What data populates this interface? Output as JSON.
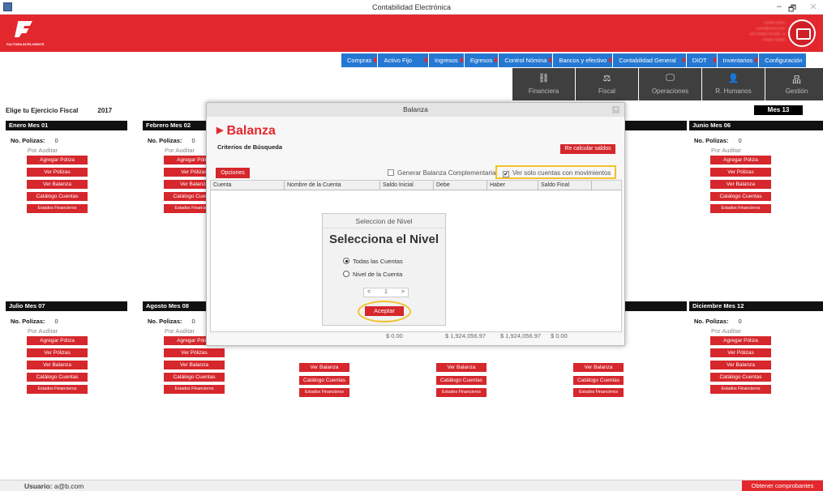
{
  "window": {
    "title": "Contabilidad Electrónica",
    "minimize": "–",
    "maximize": "🗗",
    "close": "✕"
  },
  "brand": {
    "logo_text": "FACTURA INTELIGENTE",
    "user_lines": [
      "Usuario Demo",
      "correo@correo.com",
      "RFC DEMO XXX000 - A",
      "Ciudad, Estado"
    ]
  },
  "menu": [
    {
      "label": "Compras",
      "id": "compras"
    },
    {
      "label": "Activo Fijo",
      "id": "activo-fijo"
    },
    {
      "label": "Ingresos",
      "id": "ingresos"
    },
    {
      "label": "Egresos",
      "id": "egresos"
    },
    {
      "label": "Control Nómina",
      "id": "control-nomina"
    },
    {
      "label": "Bancos y efectivo",
      "id": "bancos"
    },
    {
      "label": "Contabilidad General",
      "id": "contabilidad-general"
    },
    {
      "label": "DIOT",
      "id": "diot"
    },
    {
      "label": "Inventarios",
      "id": "inventarios"
    },
    {
      "label": "Configuración",
      "id": "configuracion"
    }
  ],
  "tiles": [
    {
      "label": "Financiera",
      "icon": "link-icon",
      "glyph": "⛓"
    },
    {
      "label": "Fiscal",
      "icon": "scale-icon",
      "glyph": "⚖"
    },
    {
      "label": "Operaciones",
      "icon": "monitor-icon",
      "glyph": "🖵"
    },
    {
      "label": "R. Humanos",
      "icon": "person-icon",
      "glyph": "👤"
    },
    {
      "label": "Gestión",
      "icon": "org-chart-icon",
      "glyph": "品"
    }
  ],
  "fiscal": {
    "label": "Elige tu Ejercicio Fiscal",
    "year": "2017",
    "mes13": "Mes 13"
  },
  "month_common": {
    "polizas_label": "No. Polizas:",
    "polizas_value": "0",
    "status": "Por Auditar",
    "btn_agregar": "Agregar Póliza",
    "btn_ver_polizas": "Ver Pólizas",
    "btn_ver_balanza": "Ver Balanza",
    "btn_catalogo": "Catálogo Cuentas",
    "btn_estados": "Estados Financieros"
  },
  "months": {
    "m01": "Enero Mes 01",
    "m02": "Febrero Mes 02",
    "m06": "Junio Mes 06",
    "m07": "Julio Mes 07",
    "m08": "Agosto Mes 08",
    "m12": "Diciembre Mes 12"
  },
  "modal": {
    "title": "Balanza",
    "close": "×",
    "heading": "Balanza",
    "criterios": "Criterios de Búsqueda",
    "recalc": "Re calcular saldos",
    "opciones": "Opciones",
    "chk_complementaria": "Generar Balanza Complementaria",
    "chk_movimientos": "Ver solo cuentas con movimientos",
    "columns": [
      "Cuenta",
      "Nombre de la Cuenta",
      "Saldo Inicial",
      "Debe",
      "Haber",
      "Saldo Final"
    ],
    "totals": {
      "saldo_inicial": "$ 0.00",
      "debe": "$ 1,924,056.97",
      "haber": "$ 1,924,056.97",
      "saldo_final": "$ 0.00"
    }
  },
  "nivel": {
    "header": "Seleccion de Nivel",
    "title": "Selecciona el Nivel",
    "opt_todas": "Todas las Cuentas",
    "opt_nivel": "Nivel de la Cuenta",
    "stepper_prev": "<",
    "stepper_value": "1",
    "stepper_next": ">",
    "aceptar": "Aceptar"
  },
  "status": {
    "user_label": "Usuario:",
    "user_value": "a@b.com",
    "obtener": "Obtener comprobantes"
  },
  "colors": {
    "brand_red": "#e3282d",
    "menu_blue": "#2478d2",
    "tile_dark": "#3f3f3f",
    "highlight": "#f3c22b"
  }
}
